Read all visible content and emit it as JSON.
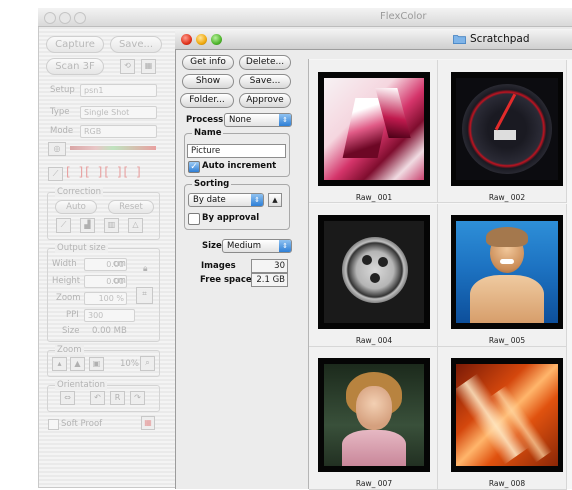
{
  "app": {
    "title": "FlexColor"
  },
  "tool_panel": {
    "capture": "Capture",
    "save": "Save...",
    "scan": "Scan 3F",
    "setup_label": "Setup",
    "setup_value": "psn1",
    "type_label": "Type",
    "type_value": "Single Shot",
    "mode_label": "Mode",
    "mode_value": "RGB",
    "correction_label": "Correction",
    "auto": "Auto",
    "reset": "Reset",
    "output_size_label": "Output size",
    "width_label": "Width",
    "width_value": "0.00",
    "height_label": "Height",
    "height_value": "0.00",
    "unit": "cm",
    "zoom_label": "Zoom",
    "zoom_value": "100 %",
    "ppi_label": "PPI",
    "ppi_value": "300",
    "size_label": "Size",
    "size_value": "0.00 MB",
    "zoom_section_label": "Zoom",
    "zoom_percent": "10%",
    "orientation_label": "Orientation",
    "soft_proof": "Soft Proof"
  },
  "scratchpad": {
    "title": "Scratchpad",
    "get_info": "Get info",
    "delete": "Delete...",
    "show": "Show",
    "save": "Save...",
    "folder": "Folder...",
    "approve": "Approve",
    "process_label": "Process",
    "process_value": "None",
    "name_label": "Name",
    "name_value": "Picture",
    "auto_increment": "Auto increment",
    "sorting_label": "Sorting",
    "sorting_value": "By date",
    "by_approval": "By approval",
    "size_label": "Size",
    "size_value": "Medium",
    "images_label": "Images",
    "images_value": "30",
    "free_space_label": "Free space",
    "free_space_value": "2.1 GB"
  },
  "thumbnails": [
    {
      "caption": "Raw_ 001"
    },
    {
      "caption": "Raw_ 002"
    },
    {
      "caption": "Raw_ 004"
    },
    {
      "caption": "Raw_ 005"
    },
    {
      "caption": "Raw_ 007"
    },
    {
      "caption": "Raw_ 008"
    }
  ],
  "colors": {
    "accent": "#2e7fd6",
    "close": "#e0331b",
    "minimize": "#f0a90e",
    "zoom": "#4fb52c"
  }
}
